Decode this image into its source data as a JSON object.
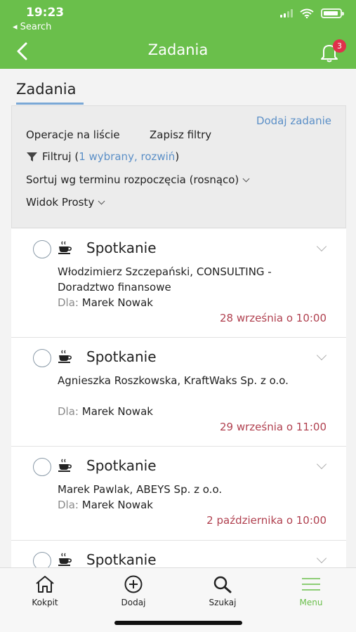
{
  "status": {
    "time": "19:23",
    "back_label": "◂ Search"
  },
  "header": {
    "title": "Zadania",
    "notifications": "3"
  },
  "page": {
    "title": "Zadania"
  },
  "filters": {
    "add_task": "Dodaj zadanie",
    "list_ops": "Operacje na liście",
    "save_filters": "Zapisz filtry",
    "filter_label": "Filtruj (",
    "filter_link": "1 wybrany, rozwiń",
    "filter_close": ")",
    "sort": "Sortuj wg terminu rozpoczęcia (rosnąco)",
    "view": "Widok Prosty"
  },
  "tasks": [
    {
      "title": "Spotkanie",
      "client": "Włodzimierz Szczepański, CONSULTING - Doradztwo finansowe",
      "for_label": "Dla:",
      "for_name": "Marek Nowak",
      "date": "28 września o 10:00"
    },
    {
      "title": "Spotkanie",
      "client": "Agnieszka Roszkowska, KraftWaks Sp. z o.o.",
      "for_label": "Dla:",
      "for_name": "Marek Nowak",
      "date": "29 września o 11:00"
    },
    {
      "title": "Spotkanie",
      "client": "Marek Pawlak, ABEYS Sp. z o.o.",
      "for_label": "Dla:",
      "for_name": "Marek Nowak",
      "date": "2 października o 10:00"
    },
    {
      "title": "Spotkanie"
    }
  ],
  "tabbar": {
    "items": [
      {
        "label": "Kokpit",
        "icon": "home-icon"
      },
      {
        "label": "Dodaj",
        "icon": "plus-circle-icon"
      },
      {
        "label": "Szukaj",
        "icon": "search-icon"
      },
      {
        "label": "Menu",
        "icon": "menu-icon"
      }
    ],
    "active": "Menu"
  },
  "colors": {
    "header": "#6abf4b",
    "link": "#5b8fc7",
    "date": "#b0404f",
    "badge": "#e0314b"
  }
}
